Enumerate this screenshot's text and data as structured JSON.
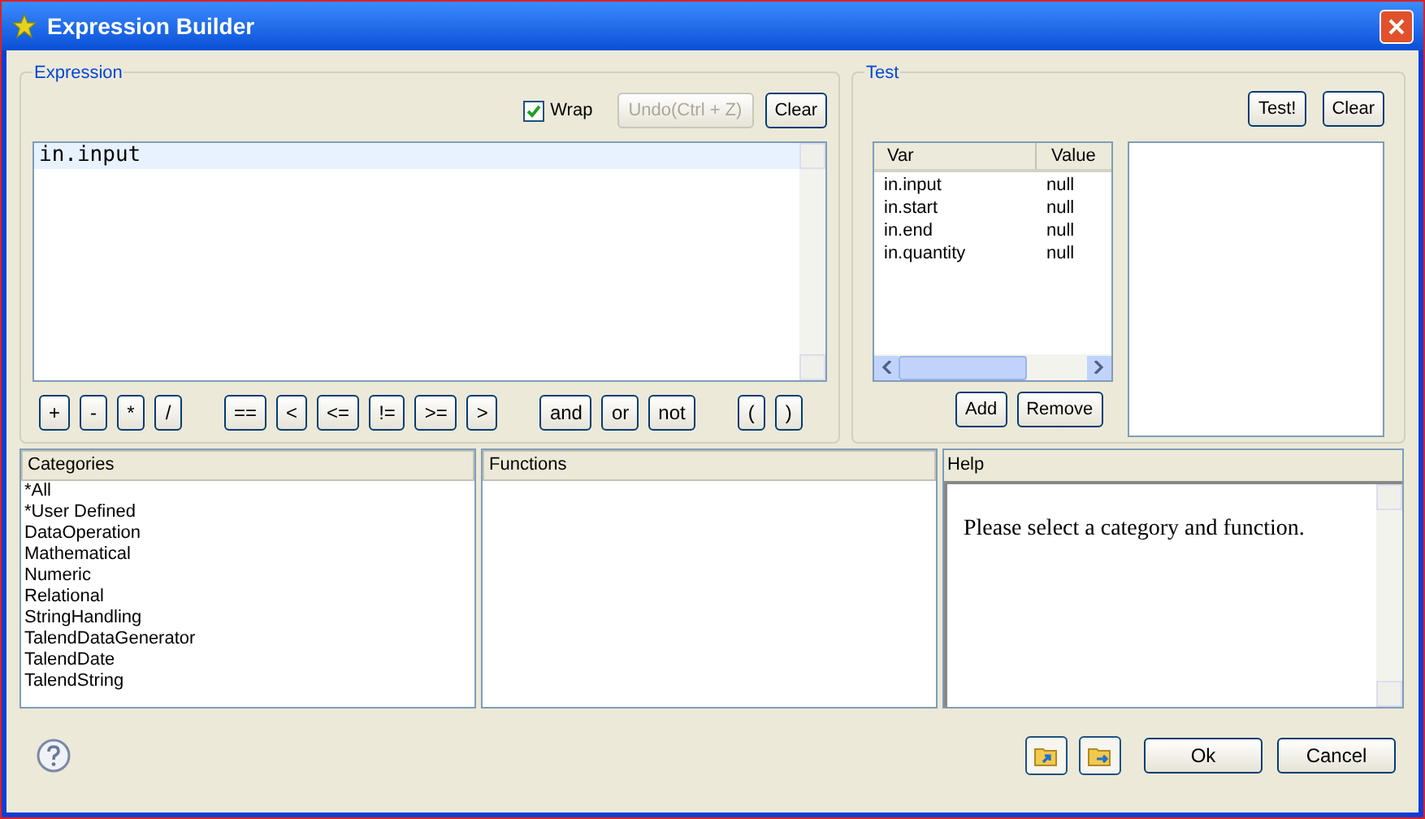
{
  "window": {
    "title": "Expression Builder"
  },
  "expression": {
    "title": "Expression",
    "wrap": {
      "label": "Wrap",
      "checked": true
    },
    "toolbar_buttons": [
      {
        "label": "Undo(Ctrl + Z)",
        "disabled": true
      },
      {
        "label": "Clear",
        "disabled": false
      }
    ],
    "lines": [
      {
        "text": "in.input",
        "selected": true
      }
    ],
    "operator_groups": [
      [
        "+",
        "-",
        "*",
        "/"
      ],
      [
        "==",
        "<",
        "<=",
        "!=",
        ">=",
        ">"
      ],
      [
        "and",
        "or",
        "not"
      ],
      [
        "(",
        ")"
      ]
    ]
  },
  "test": {
    "title": "Test",
    "buttons": [
      "Test!",
      "Clear"
    ],
    "columns": [
      "Var",
      "Value"
    ],
    "rows": [
      {
        "var": "in.input",
        "value": "null"
      },
      {
        "var": "in.start",
        "value": "null"
      },
      {
        "var": "in.end",
        "value": "null"
      },
      {
        "var": "in.quantity",
        "value": "null"
      }
    ],
    "table_buttons": [
      "Add",
      "Remove"
    ]
  },
  "categories": {
    "title": "Categories",
    "items": [
      {
        "label": "*All",
        "selected": false
      },
      {
        "label": "*User Defined",
        "selected": false
      },
      {
        "label": "DataOperation",
        "selected": false
      },
      {
        "label": "Mathematical",
        "selected": false
      },
      {
        "label": "Numeric",
        "selected": false
      },
      {
        "label": "Relational",
        "selected": false
      },
      {
        "label": "StringHandling",
        "selected": false
      },
      {
        "label": "TalendDataGenerator",
        "selected": false
      },
      {
        "label": "TalendDate",
        "selected": false
      },
      {
        "label": "TalendString",
        "selected": false
      }
    ]
  },
  "functions": {
    "title": "Functions"
  },
  "help": {
    "title": "Help",
    "text": "Please select a category and function."
  },
  "footer": {
    "buttons": [
      "Ok",
      "Cancel"
    ]
  }
}
